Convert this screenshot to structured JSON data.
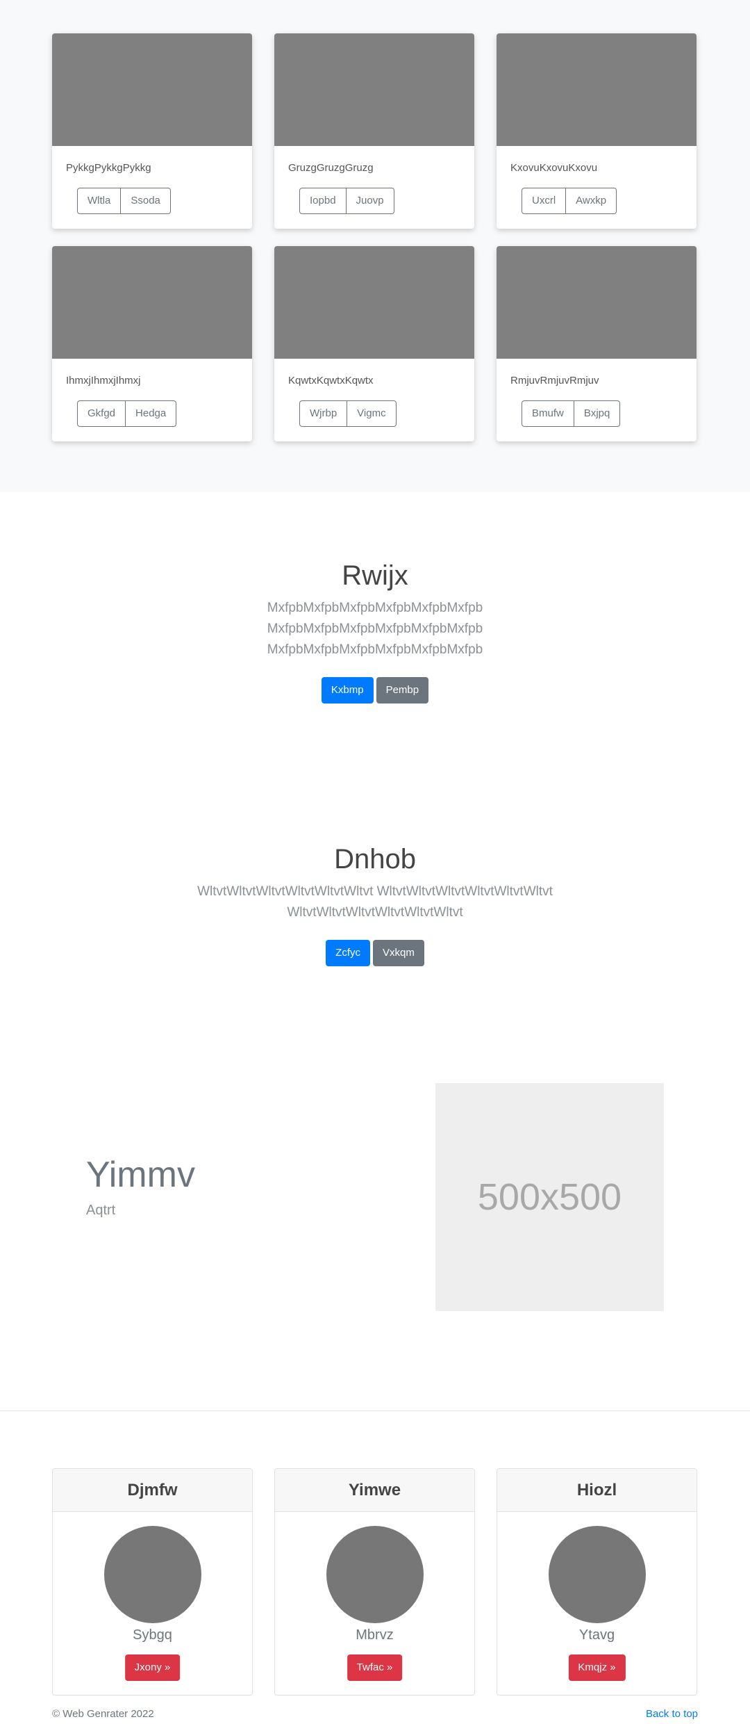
{
  "album": {
    "cards": [
      {
        "caption": "PykkgPykkgPykkg",
        "buttons": [
          "Wltla",
          "Ssoda"
        ]
      },
      {
        "caption": "GruzgGruzgGruzg",
        "buttons": [
          "Iopbd",
          "Juovp"
        ]
      },
      {
        "caption": "KxovuKxovuKxovu",
        "buttons": [
          "Uxcrl",
          "Awxkp"
        ]
      },
      {
        "caption": "IhmxjIhmxjIhmxj",
        "buttons": [
          "Gkfgd",
          "Hedga"
        ]
      },
      {
        "caption": "KqwtxKqwtxKqwtx",
        "buttons": [
          "Wjrbp",
          "Vigmc"
        ]
      },
      {
        "caption": "RmjuvRmjuvRmjuv",
        "buttons": [
          "Bmufw",
          "Bxjpq"
        ]
      }
    ]
  },
  "hero1": {
    "title": "Rwijx",
    "lines": [
      "MxfpbMxfpbMxfpbMxfpbMxfpbMxfpb",
      "MxfpbMxfpbMxfpbMxfpbMxfpbMxfpb",
      "MxfpbMxfpbMxfpbMxfpbMxfpbMxfpb"
    ],
    "primary": "Kxbmp",
    "secondary": "Pembp"
  },
  "hero2": {
    "title": "Dnhob",
    "lines": [
      "WltvtWltvtWltvtWltvtWltvtWltvt WltvtWltvtWltvtWltvtWltvtWltvt",
      "WltvtWltvtWltvtWltvtWltvtWltvt"
    ],
    "primary": "Zcfyc",
    "secondary": "Vxkqm"
  },
  "feature": {
    "heading": "Yimmv",
    "subheading": "Aqtrt",
    "placeholder": "500x500"
  },
  "profiles": [
    {
      "header": "Djmfw",
      "name": "Sybgq",
      "button": "Jxony »"
    },
    {
      "header": "Yimwe",
      "name": "Mbrvz",
      "button": "Twfac »"
    },
    {
      "header": "Hiozl",
      "name": "Ytavg",
      "button": "Kmqjz »"
    }
  ],
  "footer": {
    "copyright": "© Web Genrater 2022",
    "back_to_top": "Back to top"
  },
  "colors": {
    "primary": "#007bff",
    "secondary": "#6c757d",
    "danger": "#dc3545",
    "thumb": "#808080",
    "album_bg": "#f8f9fa"
  }
}
